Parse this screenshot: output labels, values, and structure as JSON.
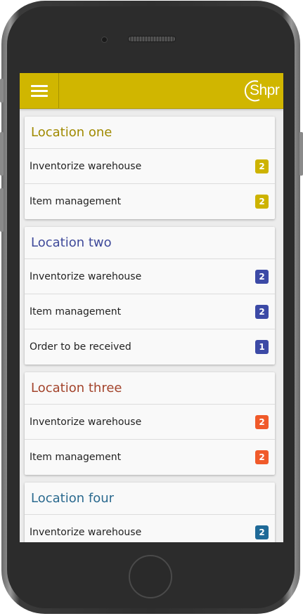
{
  "app": {
    "logo_text": "Shpr",
    "appbar_color": "#d0b600"
  },
  "locations": [
    {
      "title": "Location one",
      "title_color": "#a08a00",
      "badge_color": "#cdb300",
      "items": [
        {
          "label": "Inventorize warehouse",
          "count": "2"
        },
        {
          "label": "Item management",
          "count": "2"
        }
      ]
    },
    {
      "title": "Location two",
      "title_color": "#3f4a9a",
      "badge_color": "#3c4aa6",
      "items": [
        {
          "label": "Inventorize warehouse",
          "count": "2"
        },
        {
          "label": "Item management",
          "count": "2"
        },
        {
          "label": "Order to be received",
          "count": "1"
        }
      ]
    },
    {
      "title": "Location three",
      "title_color": "#a3442c",
      "badge_color": "#f05a2a",
      "items": [
        {
          "label": "Inventorize warehouse",
          "count": "2"
        },
        {
          "label": "Item management",
          "count": "2"
        }
      ]
    },
    {
      "title": "Location four",
      "title_color": "#2b6a8f",
      "badge_color": "#1f6a98",
      "items": [
        {
          "label": "Inventorize warehouse",
          "count": "2"
        }
      ]
    }
  ]
}
